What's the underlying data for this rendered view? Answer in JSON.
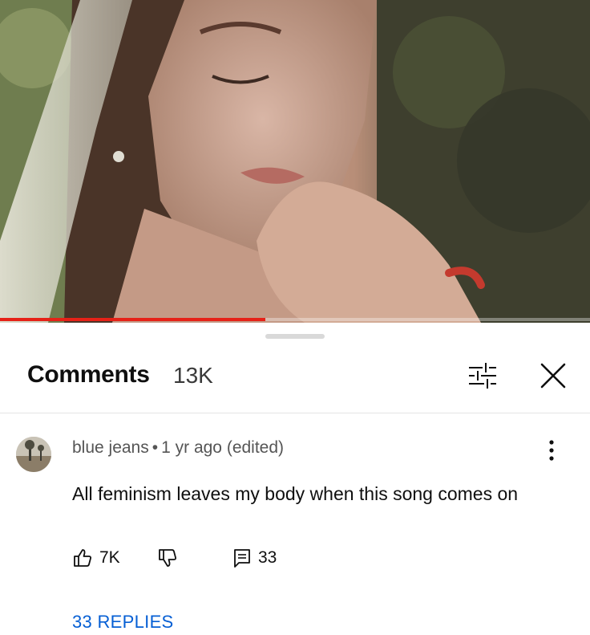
{
  "player": {
    "progress_fraction": 0.45,
    "progress_color": "#e62117"
  },
  "comments_panel": {
    "title": "Comments",
    "count": "13K",
    "filter_icon": "sort-filter-icon",
    "close_icon": "close-icon"
  },
  "comment": {
    "author": "blue jeans",
    "separator": "•",
    "timestamp": "1 yr ago (edited)",
    "text": "All feminism leaves my body when this song comes on",
    "likes": "7K",
    "reply_count": "33",
    "replies_label": "33 REPLIES",
    "accent_color": "#065fd4"
  }
}
